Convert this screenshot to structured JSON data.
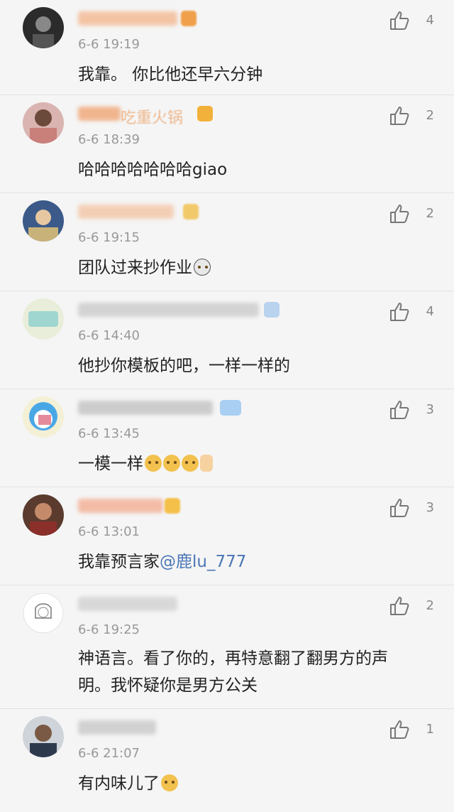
{
  "comments": [
    {
      "name": "██████████████",
      "time": "6-6 19:19",
      "likes": "4",
      "text": "我靠。 你比他还早六分钟"
    },
    {
      "name": "██▪▪▪吃重火锅",
      "time": "6-6 18:39",
      "likes": "2",
      "text": "哈哈哈哈哈哈哈giao"
    },
    {
      "name": "▪▪▪▪▪▪▪▪得",
      "time": "6-6 19:15",
      "likes": "2",
      "text": "团队过来抄作业"
    },
    {
      "name": "生活得▪▪▪▪▪▪▪▪糖",
      "time": "6-6 14:40",
      "likes": "4",
      "text": "他抄你模板的吧，一样一样的"
    },
    {
      "name": "大▪▪▪▪▪▪▪▪",
      "time": "6-6 13:45",
      "likes": "3",
      "text": "一模一样"
    },
    {
      "name": "▪▪▪▪▪▪▪▪",
      "time": "6-6 13:01",
      "likes": "3",
      "text": "我靠预言家",
      "mention": "@鹿lu_777"
    },
    {
      "name": "王▪▪▪▪不辣",
      "time": "6-6 19:25",
      "likes": "2",
      "text": "神语言。看了你的，再特意翻了翻男方的声明。我怀疑你是男方公关"
    },
    {
      "name": "▪▪▪▪▪▪",
      "time": "6-6 21:07",
      "likes": "1",
      "text": "有内味儿了"
    }
  ],
  "icons": {
    "like": "thumbs-up-icon"
  }
}
